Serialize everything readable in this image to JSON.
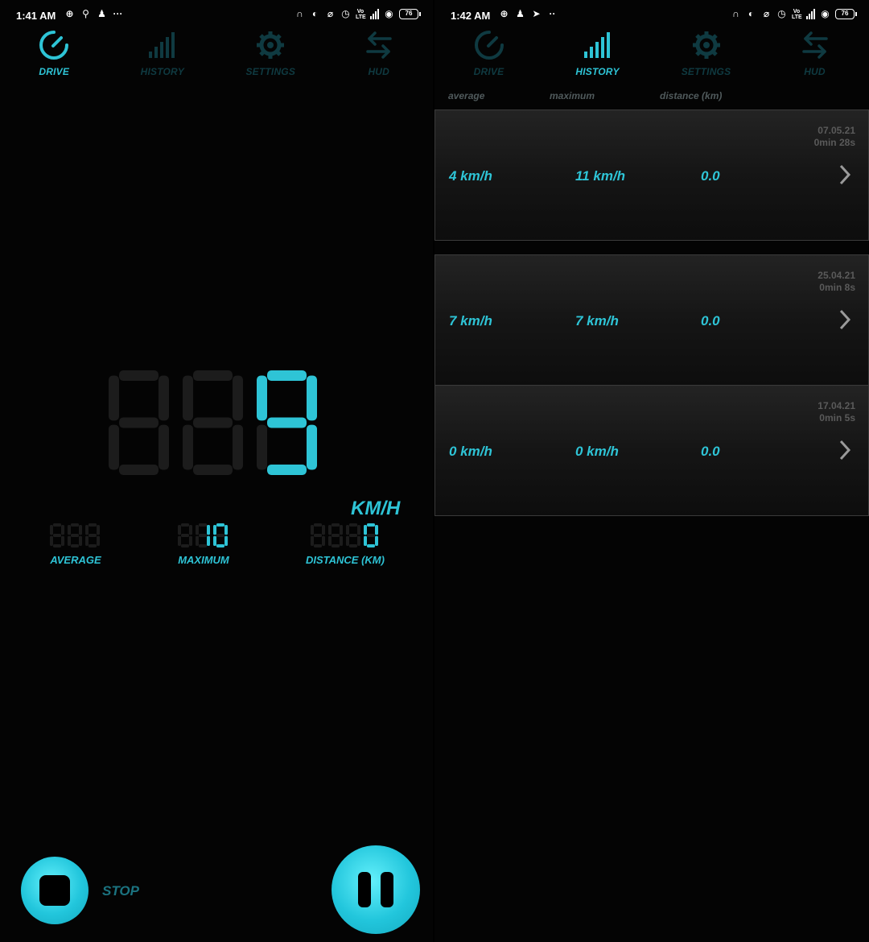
{
  "left": {
    "status": {
      "time": "1:41 AM",
      "battery": "76"
    },
    "tabs": [
      {
        "label": "DRIVE",
        "icon": "speedometer-icon",
        "active": true
      },
      {
        "label": "HISTORY",
        "icon": "signal-bars-icon",
        "active": false
      },
      {
        "label": "SETTINGS",
        "icon": "gear-icon",
        "active": false
      },
      {
        "label": "HUD",
        "icon": "swap-arrows-icon",
        "active": false
      }
    ],
    "speed": {
      "value": "9",
      "unit": "KM/H"
    },
    "stats": {
      "average": {
        "value": "",
        "label": "AVERAGE"
      },
      "maximum": {
        "value": "10",
        "label": "MAXIMUM"
      },
      "distance": {
        "value": "0",
        "label": "DISTANCE (KM)"
      }
    },
    "controls": {
      "stop_label": "STOP"
    }
  },
  "right": {
    "status": {
      "time": "1:42 AM",
      "battery": "76"
    },
    "tabs": [
      {
        "label": "DRIVE",
        "icon": "speedometer-icon",
        "active": false
      },
      {
        "label": "HISTORY",
        "icon": "signal-bars-icon",
        "active": true
      },
      {
        "label": "SETTINGS",
        "icon": "gear-icon",
        "active": false
      },
      {
        "label": "HUD",
        "icon": "swap-arrows-icon",
        "active": false
      }
    ],
    "columns": {
      "average": "average",
      "maximum": "maximum",
      "distance": "distance (km)"
    },
    "trips": [
      {
        "date": "07.05.21",
        "duration": "0min 28s",
        "average": "4 km/h",
        "maximum": "11 km/h",
        "distance": "0.0"
      },
      {
        "date": "25.04.21",
        "duration": "0min 8s",
        "average": "7 km/h",
        "maximum": "7 km/h",
        "distance": "0.0"
      },
      {
        "date": "17.04.21",
        "duration": "0min 5s",
        "average": "0 km/h",
        "maximum": "0 km/h",
        "distance": "0.0"
      }
    ]
  },
  "colors": {
    "accent": "#2ec4d6",
    "inactive": "#0f3a41",
    "unlit_segment": "#1c1c1c",
    "background": "#040404"
  }
}
